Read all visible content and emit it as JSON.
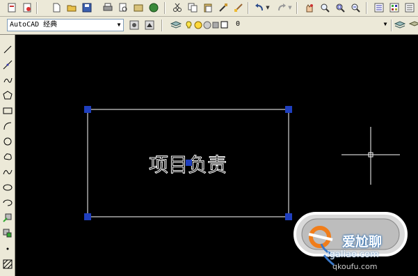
{
  "toolbar": {
    "workspace_value": "AutoCAD 经典",
    "layer_value": "0"
  },
  "drawing": {
    "text": "项目负责"
  },
  "watermark": {
    "brand": "爱尬聊",
    "domain": "igaliao.com",
    "domain2": "qkoufu.com"
  },
  "colors": {
    "canvas": "#000000",
    "grip": "#1f3fbf",
    "toolbar": "#ece9d8"
  }
}
